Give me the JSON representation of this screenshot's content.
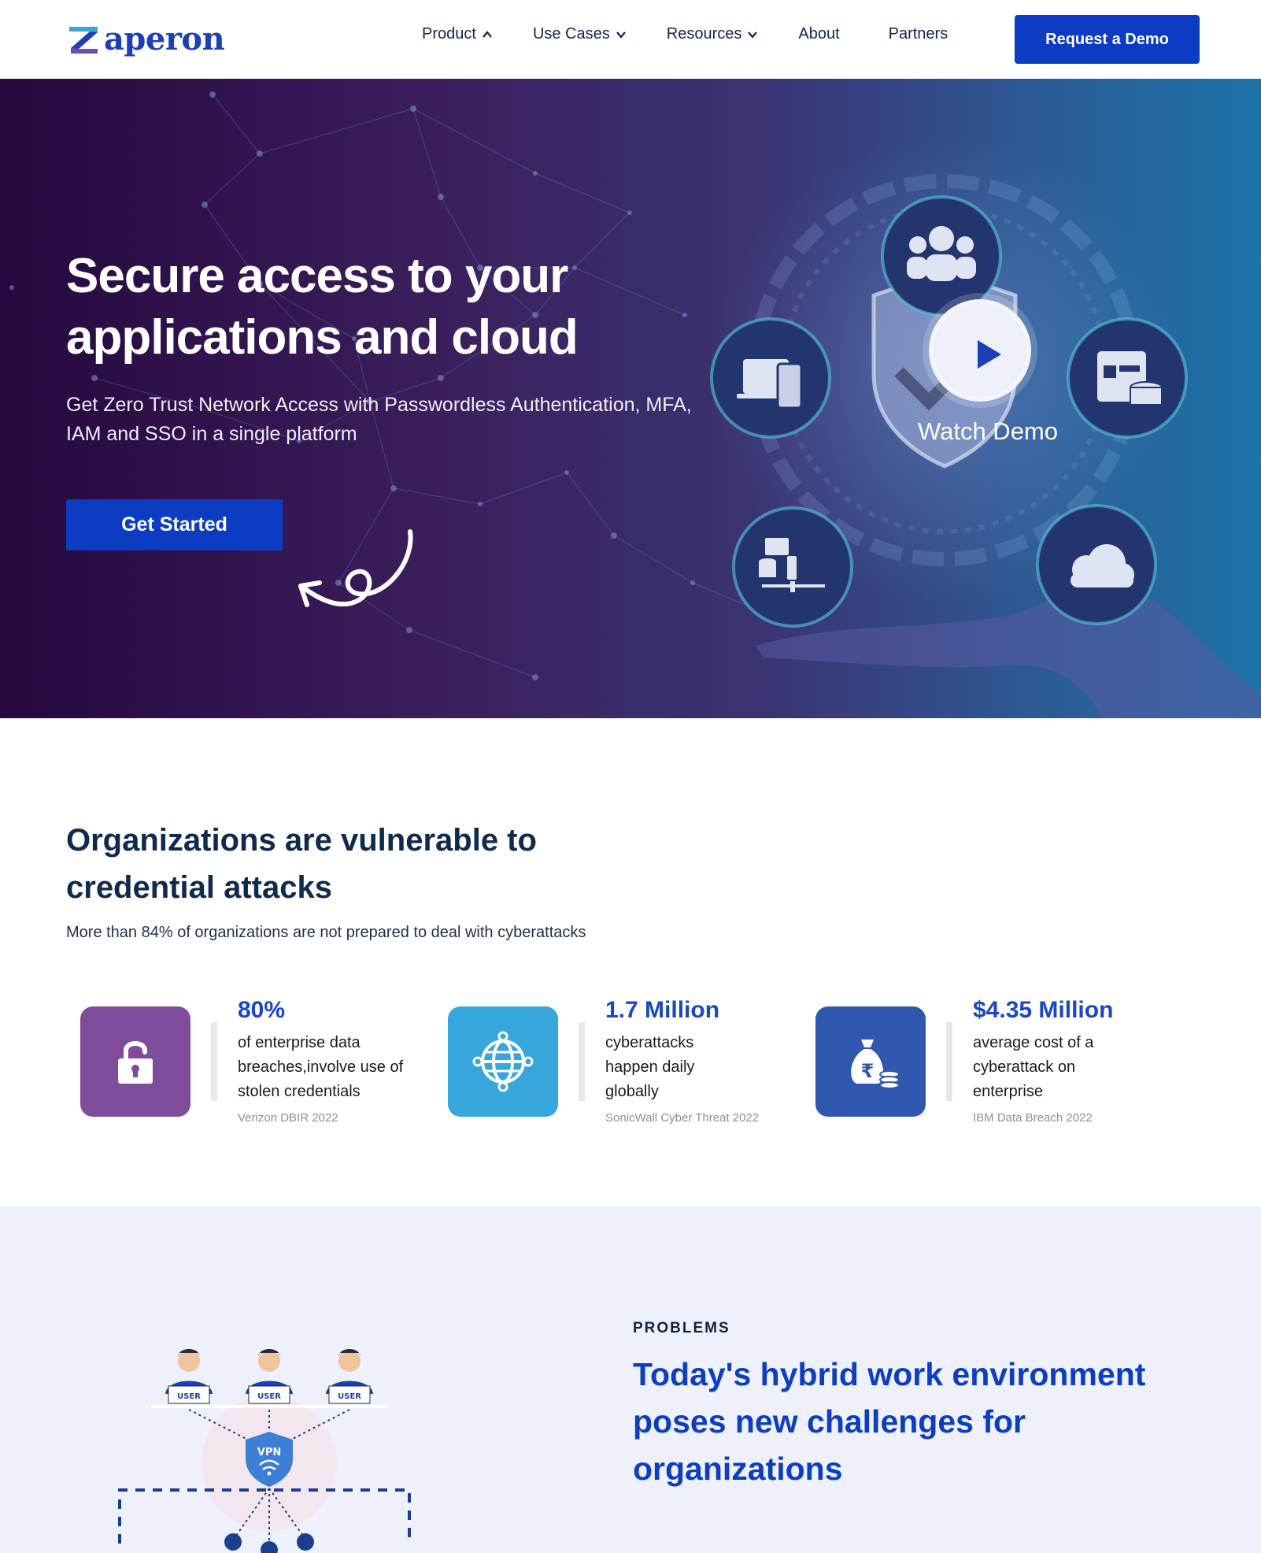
{
  "header": {
    "logo_text": "aperon",
    "nav": [
      {
        "label": "Product",
        "chevron": "up"
      },
      {
        "label": "Use Cases",
        "chevron": "down"
      },
      {
        "label": "Resources",
        "chevron": "down"
      },
      {
        "label": "About",
        "chevron": null
      },
      {
        "label": "Partners",
        "chevron": null
      }
    ],
    "cta_label": "Request a Demo"
  },
  "hero": {
    "title": "Secure access to your applications and cloud",
    "subtitle": "Get Zero Trust Network Access with Passwordless Authentication, MFA, IAM and SSO in a single platform",
    "cta_label": "Get Started",
    "watch_demo_label": "Watch Demo",
    "visual_icons": [
      "users-icon",
      "devices-icon",
      "applications-database-icon",
      "servers-network-icon",
      "cloud-icon",
      "shield-icon",
      "play-icon"
    ]
  },
  "stats": {
    "title": "Organizations are vulnerable to credential attacks",
    "subtitle": "More than 84% of organizations are not prepared to deal with cyberattacks",
    "items": [
      {
        "value": "80%",
        "description": "of enterprise data breaches,involve use of stolen credentials",
        "source": "Verizon DBIR 2022",
        "icon": "padlock-icon",
        "color": "#7e4c9b"
      },
      {
        "value": "1.7 Million",
        "description": "cyberattacks happen daily globally",
        "source": "SonicWall Cyber Threat 2022",
        "icon": "globe-icon",
        "color": "#37a6dc"
      },
      {
        "value": "$4.35 Million",
        "description": "average cost of a cyberattack on enterprise",
        "source": "IBM Data Breach 2022",
        "icon": "money-bag-icon",
        "color": "#2e57ad"
      }
    ]
  },
  "problems": {
    "eyebrow": "PROBLEMS",
    "title": "Today's hybrid work environment poses new challenges for organizations",
    "illustration": {
      "user_label": "USER",
      "vpn_label": "VPN"
    }
  },
  "colors": {
    "brand_blue": "#0c3bc4",
    "heading_navy": "#0e2a4c",
    "problems_bg": "#eef1fc"
  }
}
